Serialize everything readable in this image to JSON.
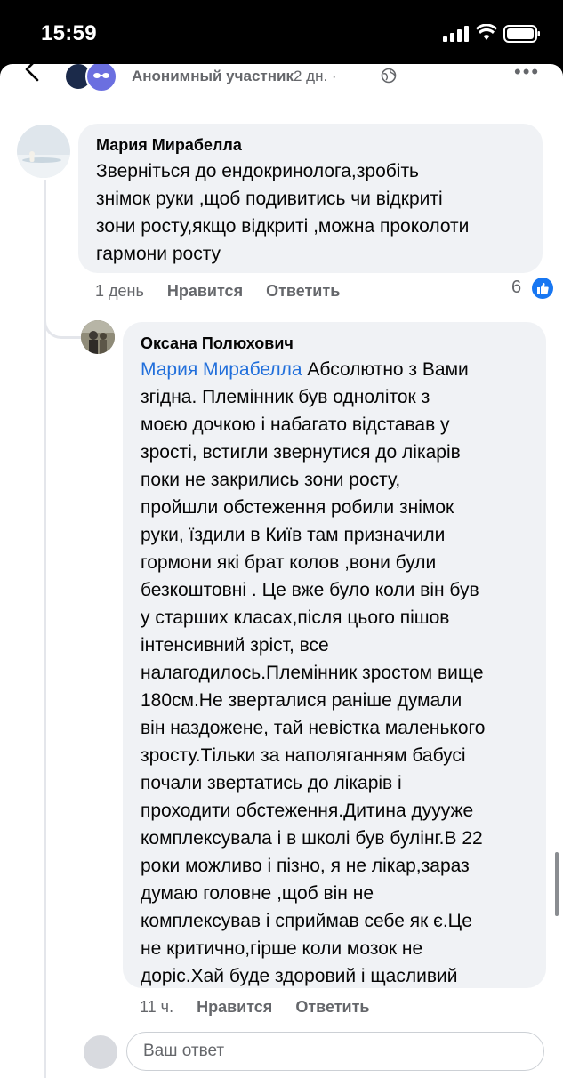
{
  "status_bar": {
    "time": "15:59"
  },
  "header": {
    "author": "Анонимный участник",
    "separator": " · ",
    "date": "2 дн. · "
  },
  "comment": {
    "author": "Мария Мирабелла",
    "text": "Зверніться до ендокринолога,зробіть\nзнімок руки ,щоб подивитись чи відкриті\nзони росту,якщо відкриті ,можна проколоти\nгармони росту",
    "time": "1 день",
    "like_label": "Нравится",
    "reply_label": "Ответить",
    "like_count": "6",
    "like_icon": "thumbs-up-icon"
  },
  "reply": {
    "author": "Оксана Полюхович",
    "mention": "Мария Мирабелла",
    "text": " Абсолютно з Вами\nзгідна. Племінник  був одноліток з\nмоєю дочкою і набагато відставав у\nзрості, встигли звернутися до лікарів\nпоки не закрились зони росту,\nпройшли обстеження робили знімок\nруки, їздили в Київ там призначили\nгормони які брат колов ,вони були\nбезкоштовні . Це вже було коли він був\nу старших класах,після цього пішов\nінтенсивний зріст, все\nналагодилось.Племінник зростом вище\n180см.Не зверталися раніше думали\nвін наздожене, тай невістка маленького\nзросту.Тільки за наполяганням бабусі\nпочали звертатись до лікарів і\nпроходити обстеження.Дитина дуууже\nкомплексувала і в школі був булінг.В 22\nроки можливо і пізно, я не лікар,зараз\nдумаю головне ,щоб він не\nкомплексував і сприймав себе як є.Це\nне критично,гірше коли мозок не\nдоріс.Хай буде здоровий і щасливий",
    "time": "11 ч.",
    "like_label": "Нравится",
    "reply_label": "Ответить"
  },
  "reply_box": {
    "placeholder": "Ваш ответ"
  }
}
